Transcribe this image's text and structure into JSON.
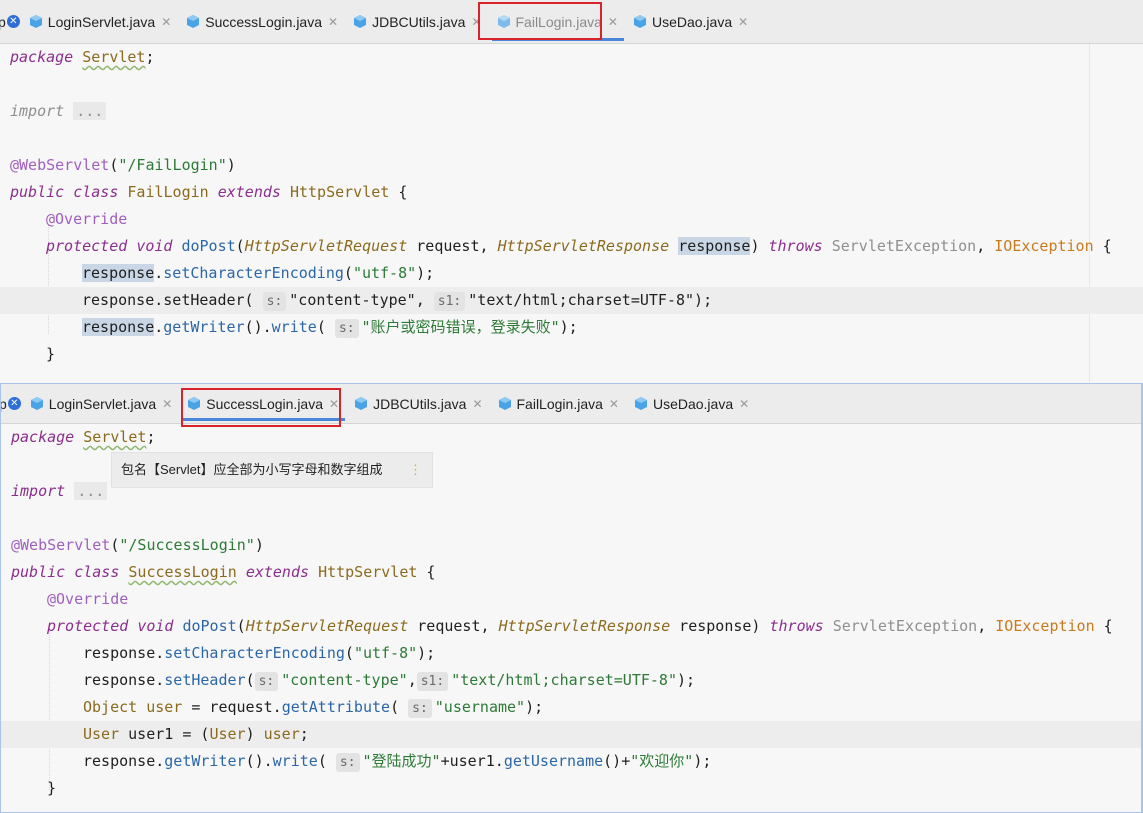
{
  "top_pane": {
    "tabs": [
      {
        "label": "p",
        "kind": "cut"
      },
      {
        "label": "LoginServlet.java"
      },
      {
        "label": "SuccessLogin.java"
      },
      {
        "label": "JDBCUtils.java"
      },
      {
        "label": "FailLogin.java",
        "active": true
      },
      {
        "label": "UseDao.java"
      }
    ],
    "code": {
      "l1_kw": "package",
      "l1_pkg": "Servlet",
      "l1_semi": ";",
      "l2_kw": "import",
      "l2_fold": "...",
      "l3_ann": "@WebServlet",
      "l3_open": "(",
      "l3_str": "\"/FailLogin\"",
      "l3_close": ")",
      "l4_kw1": "public",
      "l4_kw2": "class",
      "l4_cls": "FailLogin",
      "l4_kw3": "extends",
      "l4_sup": "HttpServlet",
      "l4_brace": " {",
      "l5_ann": "@Override",
      "l6_kw1": "protected",
      "l6_kw2": "void",
      "l6_m": "doPost",
      "l6_p1": "(",
      "l6_t1": "HttpServletRequest",
      "l6_a1": " request, ",
      "l6_t2": "HttpServletResponse",
      "l6_a2": "response",
      "l6_p2": ") ",
      "l6_throws": "throws",
      "l6_e1": "ServletException",
      "l6_comma": ", ",
      "l6_e2": "IOException",
      "l6_brace": " {",
      "l7_obj": "response",
      "l7_dot": ".",
      "l7_m": "setCharacterEncoding",
      "l7_open": "(",
      "l7_str": "\"utf-8\"",
      "l7_close": ");",
      "l8_obj": "response",
      "l8_rest1": ".setHeader(",
      "l8_h1": "s:",
      "l8_str1": "\"content-type\"",
      "l8_comma": ", ",
      "l8_h2": "s1:",
      "l8_str2": "\"text/html;charset=UTF-8\"",
      "l8_close": ");",
      "l9_obj": "response",
      "l9_dot": ".",
      "l9_m1": "getWriter",
      "l9_mid": "().",
      "l9_m2": "write",
      "l9_open": "(",
      "l9_h1": "s:",
      "l9_str": "\"账户或密码错误，登录失败\"",
      "l9_close": ");",
      "l10": "}"
    }
  },
  "bottom_pane": {
    "tabs": [
      {
        "label": "p",
        "kind": "cut"
      },
      {
        "label": "LoginServlet.java"
      },
      {
        "label": "SuccessLogin.java",
        "active": true
      },
      {
        "label": "JDBCUtils.java"
      },
      {
        "label": "FailLogin.java"
      },
      {
        "label": "UseDao.java"
      }
    ],
    "tooltip": {
      "text": "包名【Servlet】应全部为小写字母和数字组成",
      "more": "⋮"
    },
    "code": {
      "l1_kw": "package",
      "l1_pkg": "Servlet",
      "l1_semi": ";",
      "l2_kw": "import",
      "l2_fold": "...",
      "l3_ann": "@WebServlet",
      "l3_open": "(",
      "l3_str": "\"/SuccessLogin\"",
      "l3_close": ")",
      "l4_kw1": "public",
      "l4_kw2": "class",
      "l4_cls": "SuccessLogin",
      "l4_kw3": "extends",
      "l4_sup": "HttpServlet",
      "l4_brace": " {",
      "l5_ann": "@Override",
      "l6_kw1": "protected",
      "l6_kw2": "void",
      "l6_m": "doPost",
      "l6_p1": "(",
      "l6_t1": "HttpServletRequest",
      "l6_a1": " request, ",
      "l6_t2": "HttpServletResponse",
      "l6_a2": " response) ",
      "l6_throws": "throws",
      "l6_e1": "ServletException",
      "l6_comma": ", ",
      "l6_e2": "IOException",
      "l6_brace": " {",
      "l7_obj": "response.",
      "l7_m": "setCharacterEncoding",
      "l7_open": "(",
      "l7_str": "\"utf-8\"",
      "l7_close": ");",
      "l8_obj": "response.",
      "l8_m": "setHeader",
      "l8_open": "(",
      "l8_h1": "s:",
      "l8_str1": "\"content-type\"",
      "l8_comma": ",",
      "l8_h2": "s1:",
      "l8_str2": "\"text/html;charset=UTF-8\"",
      "l8_close": ");",
      "l9_type": "Object",
      "l9_var": " user",
      "l9_eq": " = request.",
      "l9_m": "getAttribute",
      "l9_open": "(",
      "l9_h1": "s:",
      "l9_str": "\"username\"",
      "l9_close": ");",
      "l10_type": "User",
      "l10_var": " user1",
      "l10_eq": " = (",
      "l10_cast": "User",
      "l10_rest": ") ",
      "l10_user": "user",
      "l10_semi": ";",
      "l11_obj": "response.",
      "l11_m1": "getWriter",
      "l11_mid": "().",
      "l11_m2": "write",
      "l11_open": "(",
      "l11_h1": "s:",
      "l11_str1": "\"登陆成功\"",
      "l11_plus1": "+user1.",
      "l11_m3": "getUsername",
      "l11_plus2": "()+",
      "l11_str2": "\"欢迎你\"",
      "l11_close": ");",
      "l12": "}"
    }
  }
}
